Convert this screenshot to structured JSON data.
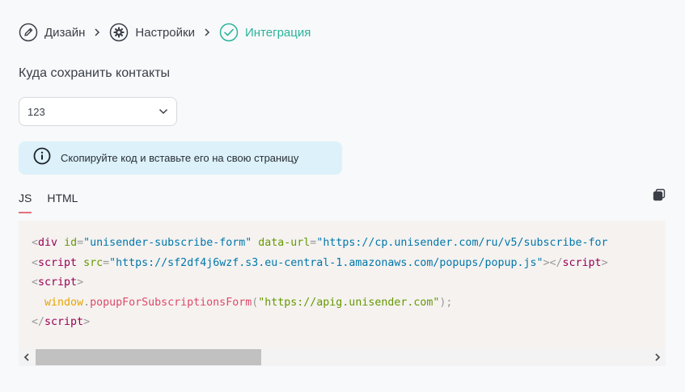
{
  "stepper": {
    "steps": [
      {
        "label": "Дизайн",
        "icon": "pencil-icon"
      },
      {
        "label": "Настройки",
        "icon": "gear-icon"
      },
      {
        "label": "Интеграция",
        "icon": "check-circle-icon"
      }
    ],
    "separator_icon": "chevron-right-icon",
    "active_color": "#2bb39a"
  },
  "contacts": {
    "label": "Куда сохранить контакты",
    "select_value": "123"
  },
  "info": {
    "text": "Скопируйте код и вставьте его на свою страницу"
  },
  "tabs": [
    {
      "label": "JS",
      "active": true
    },
    {
      "label": "HTML",
      "active": false
    }
  ],
  "code": {
    "line1": {
      "open": "<",
      "tag": "div",
      "attr1": "id",
      "eq1": "=",
      "val1": "\"unisender-subscribe-form\"",
      "attr2": "data-url",
      "eq2": "=",
      "val2": "\"https://cp.unisender.com/ru/v5/subscribe-for"
    },
    "line2": {
      "open": "<",
      "tag": "script",
      "attr": "src",
      "eq": "=",
      "val": "\"https://sf2df4j6wzf.s3.eu-central-1.amazonaws.com/popups/popup.js\"",
      "close": "></",
      "tag2": "script",
      "end": ">"
    },
    "line3": {
      "open": "<",
      "tag": "script",
      "close": ">"
    },
    "line4": {
      "obj": "window",
      "dot": ".",
      "fn": "popupForSubscriptionsForm",
      "paren_open": "(",
      "arg": "\"https://apig.unisender.com\"",
      "paren_close": ");"
    },
    "line5": {
      "open": "</",
      "tag": "script",
      "close": ">"
    }
  },
  "colors": {
    "accent": "#2bb39a",
    "info_bg": "#dcf1fa",
    "tab_underline": "#e2727a",
    "code_bg": "#f5f2f0"
  }
}
